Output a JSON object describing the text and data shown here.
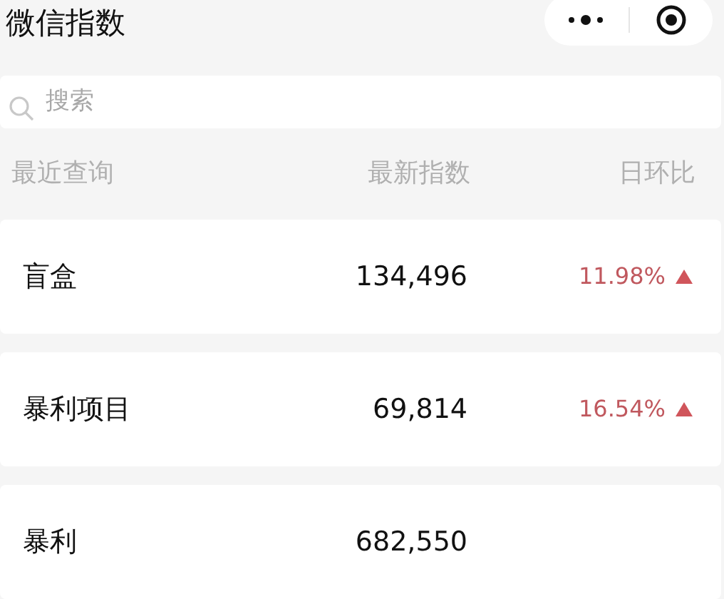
{
  "title": "微信指数",
  "search": {
    "placeholder": "搜索"
  },
  "columns": [
    "最近查询",
    "最新指数",
    "日环比"
  ],
  "rows": [
    {
      "keyword": "盲盒",
      "index": "134,496",
      "change": "11.98%",
      "rising": true
    },
    {
      "keyword": "暴利项目",
      "index": "69,814",
      "change": "16.54%",
      "rising": true
    },
    {
      "keyword": "暴利",
      "index": "682,550"
    }
  ]
}
